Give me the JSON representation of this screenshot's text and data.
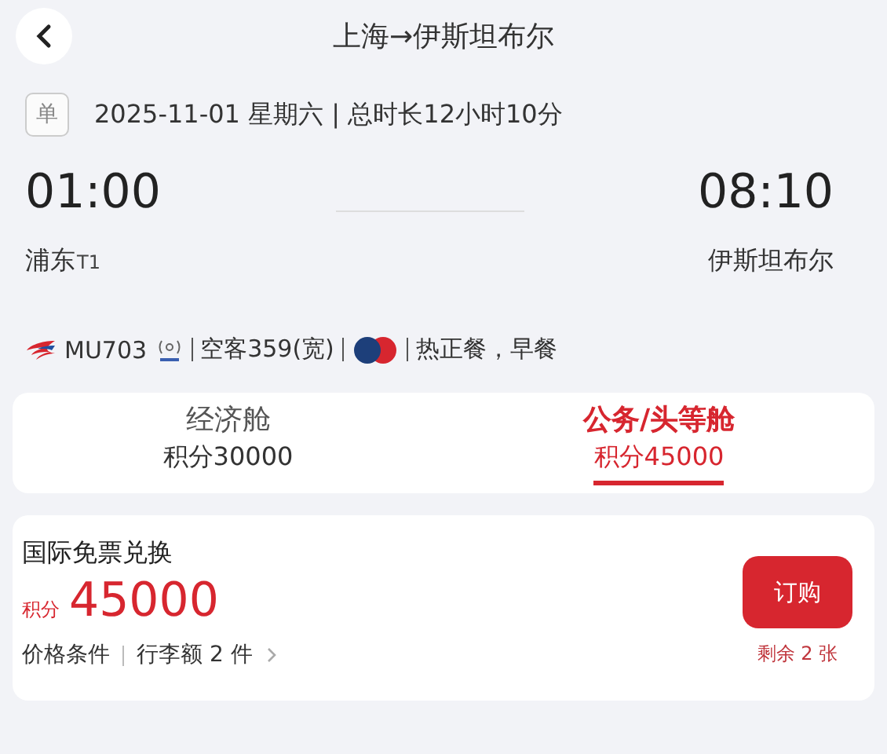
{
  "header": {
    "title": "上海→伊斯坦布尔"
  },
  "trip": {
    "badge": "单",
    "date_line": "2025-11-01 星期六 | 总时长12小时10分"
  },
  "departure": {
    "time": "01:00",
    "airport": "浦东",
    "terminal": "T1"
  },
  "arrival": {
    "time": "08:10",
    "airport": "伊斯坦布尔"
  },
  "flight": {
    "number": "MU703",
    "aircraft": "空客359(宽)",
    "meal": "热正餐，早餐"
  },
  "cabins": [
    {
      "name": "经济舱",
      "points": "积分30000",
      "selected": false
    },
    {
      "name": "公务/头等舱",
      "points": "积分45000",
      "selected": true
    }
  ],
  "offer": {
    "title": "国际免票兑换",
    "points_label": "积分",
    "points": "45000",
    "conditions": [
      "价格条件",
      "行李额 2 件"
    ],
    "button": "订购",
    "remaining": "剩余 2 张"
  }
}
